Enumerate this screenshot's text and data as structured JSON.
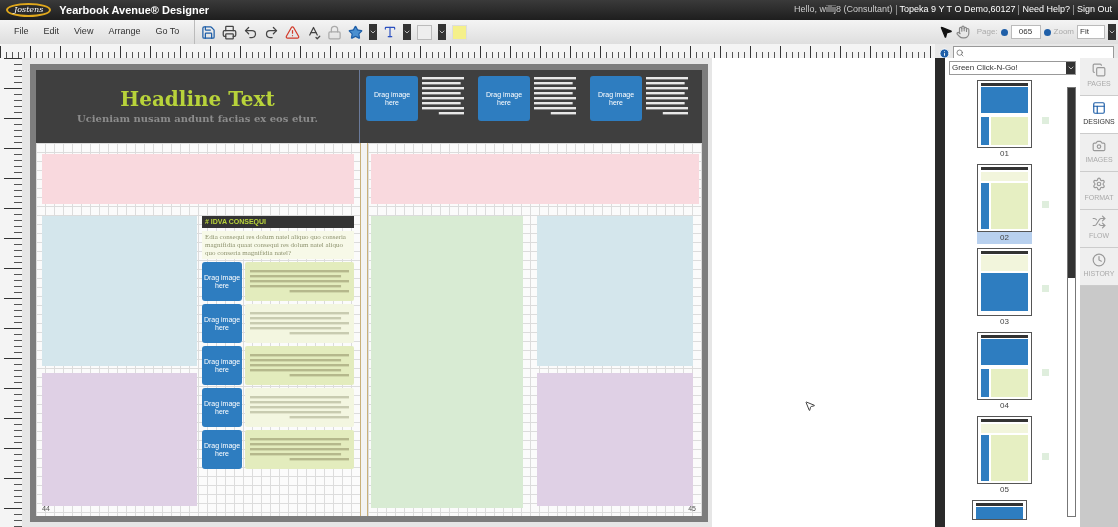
{
  "title_bar": {
    "logo": "Jostens",
    "app_name": "Yearbook Avenue® Designer",
    "links": [
      "Hello, willij8 (Consultant)",
      "Topeka 9 Y T O Demo,60127",
      "Need Help?",
      "Sign Out"
    ]
  },
  "menu": [
    "File",
    "Edit",
    "View",
    "Arrange",
    "Go To"
  ],
  "page_nav": {
    "label": "Page:",
    "value": "065",
    "zoom_label": "Zoom",
    "zoom_value": "Fit"
  },
  "spread": {
    "headline": "Headline Text",
    "subheadline": "Ucieniam nusam andunt facias ex eos etur.",
    "header_tiles": [
      {
        "label": "Drag image here"
      },
      {
        "label": "Drag image here"
      },
      {
        "label": "Drag image here"
      }
    ],
    "section_title": "# IDVA CONSEQUI",
    "intro": "Edia consequi res dolum natel aliquo quo conseria magnifidia quaat consequi res dolum natel aliquo quo conseria magnifidia natel?",
    "quotes": [
      {
        "image_label": "Drag image here",
        "highlighted": true
      },
      {
        "image_label": "Drag image here",
        "highlighted": false
      },
      {
        "image_label": "Drag image here",
        "highlighted": true
      },
      {
        "image_label": "Drag image here",
        "highlighted": false
      },
      {
        "image_label": "Drag image here",
        "highlighted": true
      }
    ],
    "page_numbers": [
      "44",
      "45"
    ]
  },
  "sidebar": {
    "design_set": "Green Click-N-Go!",
    "thumbnails": [
      {
        "label": "01",
        "selected": false
      },
      {
        "label": "02",
        "selected": true
      },
      {
        "label": "03",
        "selected": false
      },
      {
        "label": "04",
        "selected": false
      },
      {
        "label": "05",
        "selected": false
      }
    ],
    "tabs": [
      {
        "label": "PAGES",
        "selected": false
      },
      {
        "label": "DESIGNS",
        "selected": true
      },
      {
        "label": "IMAGES",
        "selected": false
      },
      {
        "label": "FORMAT",
        "selected": false
      },
      {
        "label": "FLOW",
        "selected": false
      },
      {
        "label": "HISTORY",
        "selected": false
      }
    ]
  }
}
